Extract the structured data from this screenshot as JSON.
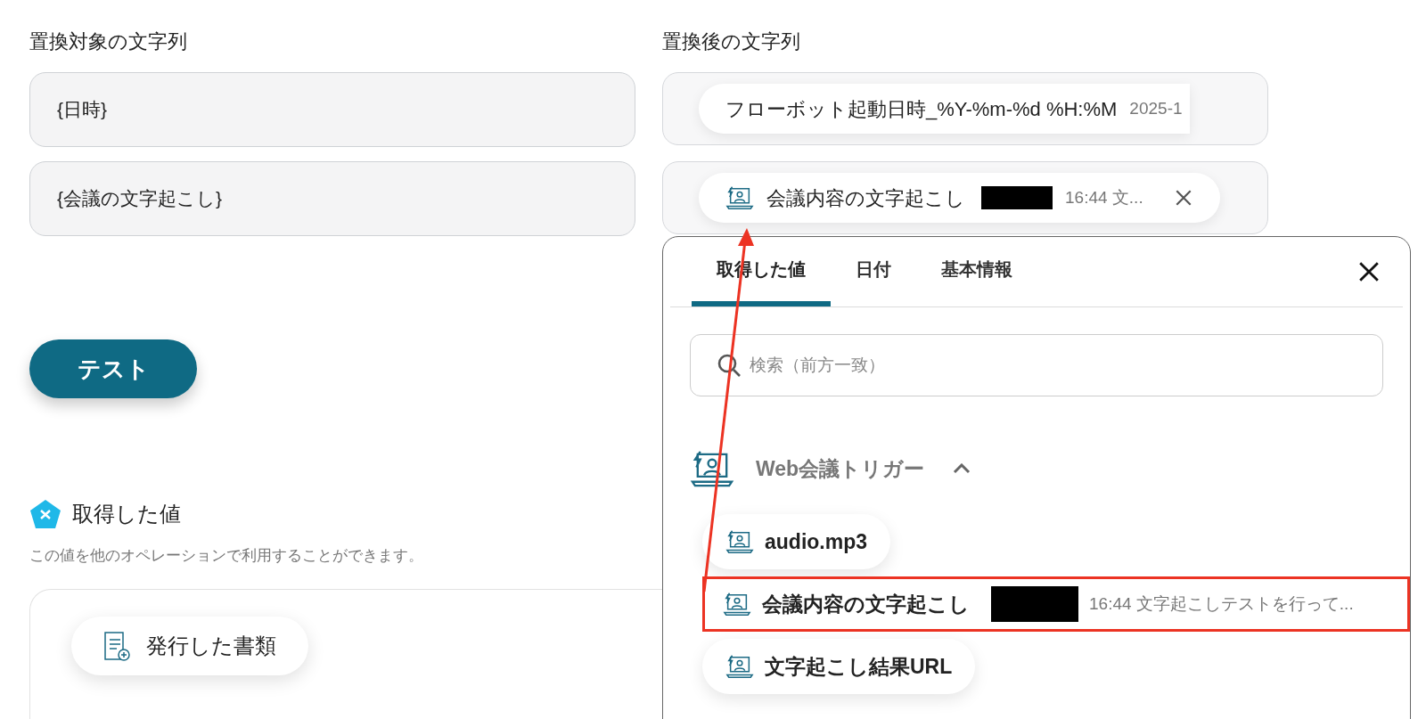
{
  "replace_from": {
    "label": "置換対象の文字列",
    "fields": [
      "{日時}",
      "{会議の文字起こし}"
    ]
  },
  "replace_to": {
    "label": "置換後の文字列",
    "fields": [
      {
        "kind": "plain",
        "text": "フローボット起動日時_%Y-%m-%d %H:%M",
        "redacted": false,
        "preview": "2025-1"
      },
      {
        "kind": "trigger",
        "text": "会議内容の文字起こし",
        "redacted": true,
        "preview": "16:44 文..."
      }
    ]
  },
  "test_button": "テスト",
  "outputs": {
    "title": "取得した値",
    "description": "この値を他のオペレーションで利用することができます。",
    "items": [
      {
        "label": "発行した書類"
      }
    ]
  },
  "picker": {
    "tabs": [
      {
        "label": "取得した値",
        "selected": true
      },
      {
        "label": "日付",
        "selected": false
      },
      {
        "label": "基本情報",
        "selected": false
      }
    ],
    "search": {
      "placeholder": "検索（前方一致）"
    },
    "group": {
      "title": "Web会議トリガー",
      "expanded": true,
      "items": [
        {
          "label": "audio.mp3",
          "redacted": false,
          "highlighted": false
        },
        {
          "label": "会議内容の文字起こし",
          "redacted": true,
          "preview": "16:44 文字起こしテストを行って...",
          "highlighted": true
        },
        {
          "label": "文字起こし結果URL",
          "redacted": false,
          "highlighted": false
        }
      ]
    }
  }
}
